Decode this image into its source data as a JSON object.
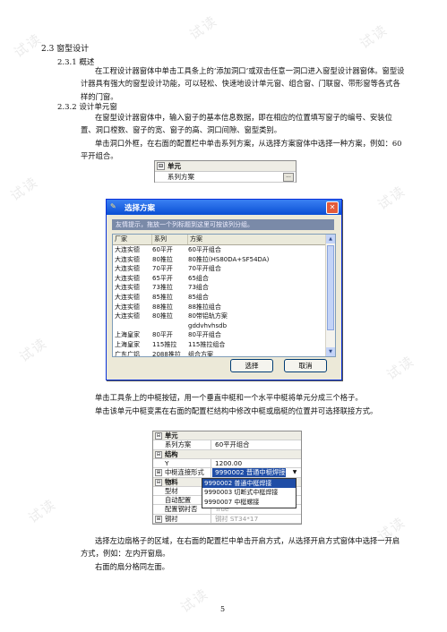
{
  "watermark": "试读",
  "heading_2_3": "2.3 窗型设计",
  "heading_2_3_1": "2.3.1  概述",
  "para_1": "在工程设计器窗体中单击工具条上的‘添加洞口’或双击任意一洞口进入窗型设计器窗体。窗型设计器具有强大的窗型设计功能，可以轻松、快速地设计单元窗、组合窗、门联窗、带形窗等各式各样的门窗。",
  "heading_2_3_2": "2.3.2  设计单元窗",
  "para_2": "在窗型设计器窗体中，输入窗子的基本信息数据，即在相应的位置填写窗子的编号、安装位置、洞口樘数、窗子的宽、窗子的高、洞口间隙、窗型类别。",
  "para_3": "单击洞口外框，在右面的配置栏中单击系列方案，从选择方案窗体中选择一种方案，例如：60平开组合。",
  "grid1": {
    "group": "单元",
    "toggle": "⊟",
    "row_label": "系列方案",
    "ellipsis": "..."
  },
  "dialog": {
    "title": "选择方案",
    "hint": "友情提示，拖放一个列标题到这里可按该列分组。",
    "columns": [
      "厂家",
      "系列",
      "方案"
    ],
    "rows": [
      [
        "大连实德",
        "60平开",
        "60平开组合"
      ],
      [
        "大连实德",
        "80推拉",
        "80推拉(HS80DA+SF54DA)"
      ],
      [
        "大连实德",
        "70平开",
        "70平开组合"
      ],
      [
        "大连实德",
        "65平开",
        "65组合"
      ],
      [
        "大连实德",
        "73推拉",
        "73组合"
      ],
      [
        "大连实德",
        "85推拉",
        "85组合"
      ],
      [
        "大连实德",
        "88推拉",
        "88推拉组合"
      ],
      [
        "大连实德",
        "80推拉",
        "80带铝轨方案"
      ],
      [
        "",
        "",
        "gddvhvhsdb"
      ],
      [
        "上海皇家",
        "80平开",
        "80平开组合"
      ],
      [
        "上海皇家",
        "115推拉",
        "115推拉组合"
      ],
      [
        "广东广铝",
        "2088推拉",
        "组合方案"
      ]
    ],
    "ok_button": "选择",
    "cancel_button": "取消"
  },
  "para_4": "单击工具条上的中梃按钮，用一个垂直中梃和一个水平中梃将单元分成三个格子。",
  "para_5": "单击该单元中梃变黑在右面的配置栏结构中修改中梃或扇梃的位置并可选择联接方式。",
  "grid2": {
    "rows": [
      {
        "toggle": "⊟",
        "key": "单元",
        "value": "",
        "group": true
      },
      {
        "toggle": "",
        "key": "系列方案",
        "value": "60平开组合",
        "group": false
      },
      {
        "toggle": "⊟",
        "key": "结构",
        "value": "",
        "group": true
      },
      {
        "toggle": "",
        "key": "Y",
        "value": "1200.00",
        "group": false
      },
      {
        "toggle": "⊞",
        "key": "中梃连接形式",
        "value": "9990002 普通中梃焊接",
        "group": false
      },
      {
        "toggle": "⊟",
        "key": "物料",
        "value": "",
        "group": true
      },
      {
        "toggle": "",
        "key": "型材",
        "value": "",
        "group": false
      },
      {
        "toggle": "",
        "key": "自动配置",
        "value": "",
        "group": false
      },
      {
        "toggle": "",
        "key": "配置钢衬否",
        "value": "True",
        "group": false
      },
      {
        "toggle": "⊞",
        "key": "钢衬",
        "value": "钢衬 ST34*17",
        "group": false
      }
    ],
    "dropdown_arrow": "▼",
    "dropdown_options": [
      "9990002 普通中梃焊接",
      "9990003 切断式中梃焊接",
      "9990007 中梃螺接"
    ]
  },
  "para_6": "选择左边扇格子的区域，在右面的配置栏中单击开启方式，从选择开启方式窗体中选择一开启方式，例如：左内开窗扇。",
  "para_7": "右面的扇分格同左面。",
  "page_number": "5"
}
